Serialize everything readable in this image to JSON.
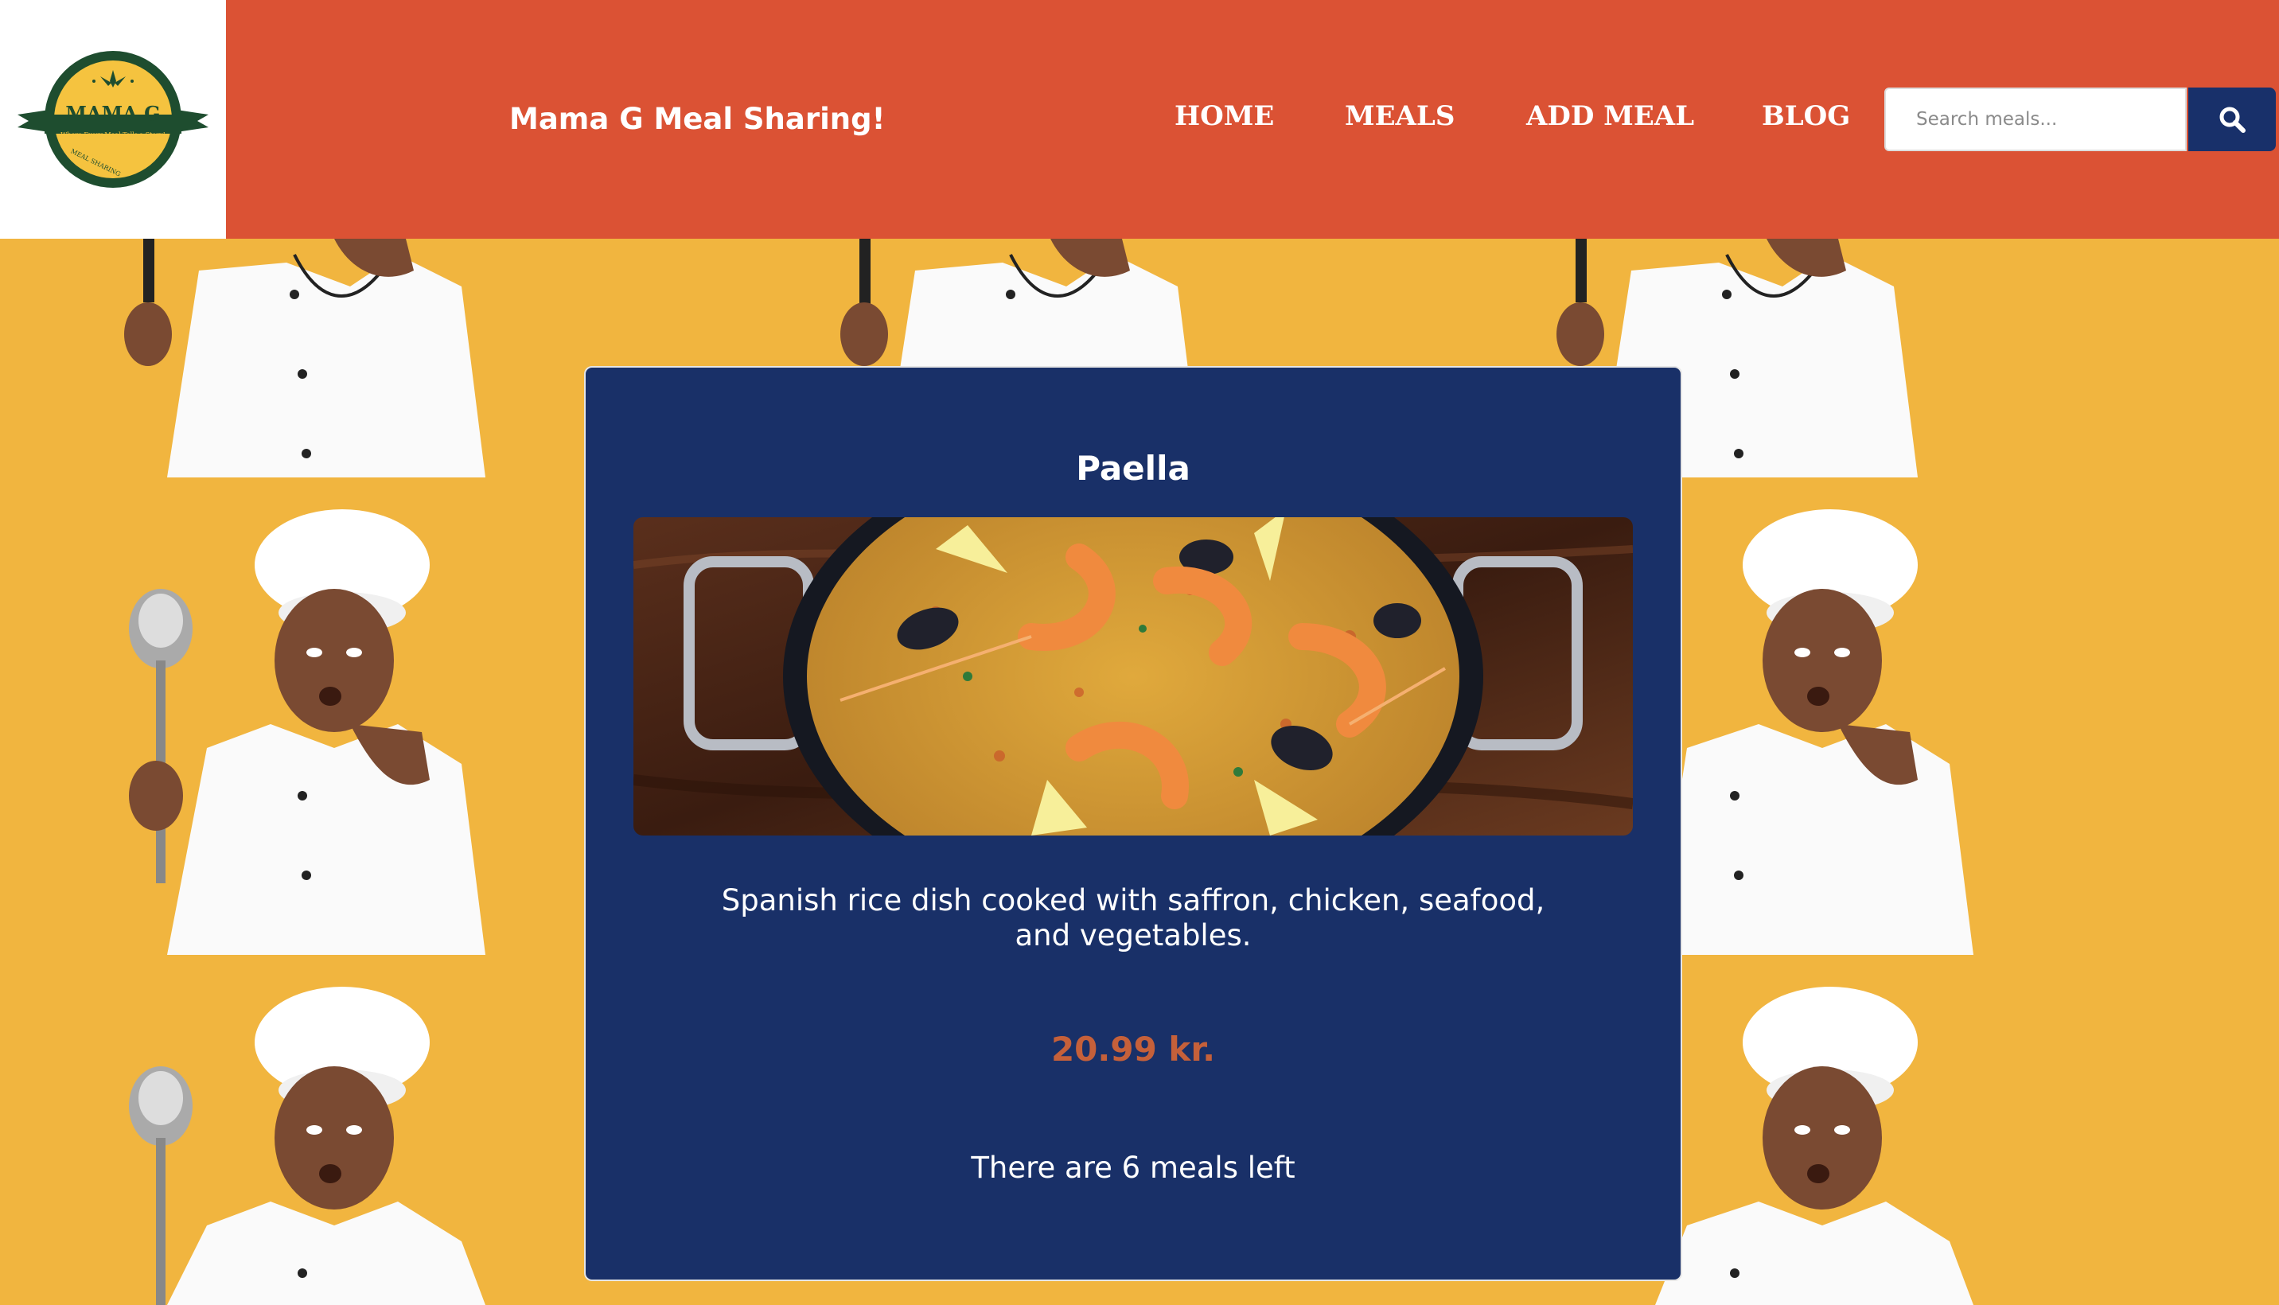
{
  "header": {
    "logo": {
      "name": "MAMA G",
      "tagline": "Where Every Meal Tells a Story!",
      "arc_text": "MEAL SHARING"
    },
    "site_title": "Mama G Meal Sharing!",
    "nav": {
      "home": "HOME",
      "meals": "MEALS",
      "add_meal": "ADD MEAL",
      "blog": "BLOG"
    },
    "search": {
      "placeholder": "Search meals...",
      "icon": "search-icon"
    }
  },
  "meal": {
    "title": "Paella",
    "image": "paella-pan-image",
    "description": "Spanish rice dish cooked with saffron, chicken, seafood, and vegetables.",
    "price": "20.99 kr.",
    "availability": "There are 6 meals left"
  },
  "colors": {
    "header_bg": "#db5234",
    "page_bg": "#f1b53f",
    "card_bg": "#193068",
    "search_button": "#18306a",
    "price": "#c5603a",
    "logo_green": "#1e4d2f",
    "logo_yellow": "#f5c33f"
  }
}
